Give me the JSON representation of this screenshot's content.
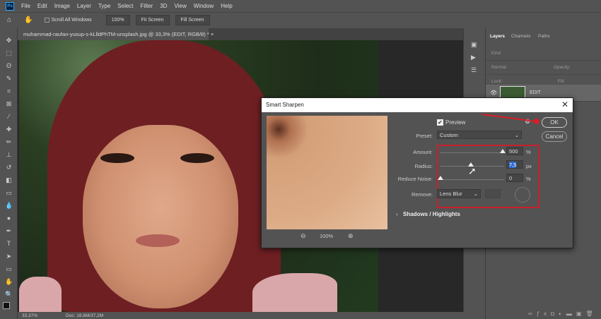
{
  "menu": {
    "logo": "Ps",
    "items": [
      "File",
      "Edit",
      "Image",
      "Layer",
      "Type",
      "Select",
      "Filter",
      "3D",
      "View",
      "Window",
      "Help"
    ]
  },
  "options": {
    "scroll_all": "Scroll All Windows",
    "zoom": "100%",
    "fit": "Fit Screen",
    "fill": "Fill Screen"
  },
  "document_tab": {
    "title": "muhammad-raufan-yusup-s-kLlldPhTM-unsplash.jpg @ 33,3% (EDIT, RGB/8) *",
    "close": "×"
  },
  "status": {
    "zoom": "33,37%",
    "doc": "Doc: 18,6M/37,2M"
  },
  "layers_panel": {
    "tabs": [
      "Layers",
      "Channels",
      "Paths"
    ],
    "kind": "Kind",
    "blend": "Normal",
    "opacity_label": "Opacity:",
    "lock_label": "Lock:",
    "fill_label": "Fill:",
    "layer_name": "EDIT"
  },
  "dialog": {
    "title": "Smart Sharpen",
    "close": "✕",
    "preview_label": "Preview",
    "preset_label": "Preset:",
    "preset_value": "Custom",
    "amount_label": "Amount:",
    "amount": "500",
    "amount_unit": "%",
    "amount_frac": 0.98,
    "radius_label": "Radius:",
    "radius": "7,5",
    "radius_unit": "px",
    "radius_frac": 0.48,
    "noise_label": "Reduce Noise:",
    "noise": "0",
    "noise_unit": "%",
    "remove_label": "Remove:",
    "remove_value": "Lens Blur",
    "shadows": "Shadows / Highlights",
    "zoom": "100%",
    "ok": "OK",
    "cancel": "Cancel"
  },
  "colors": {
    "accent": "#c8202b"
  }
}
